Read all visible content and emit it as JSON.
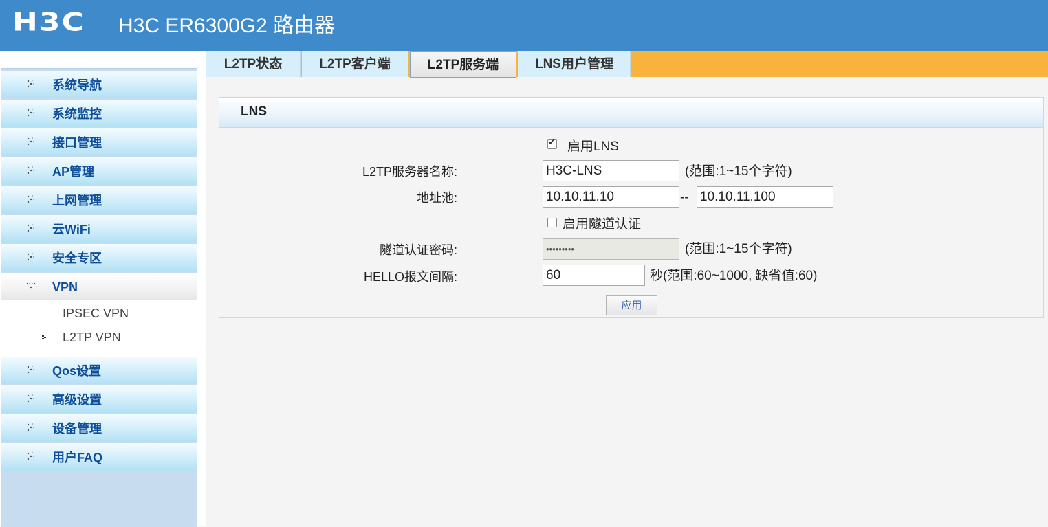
{
  "header": {
    "logo": "H3C",
    "title": "H3C ER6300G2 路由器"
  },
  "sidebar": {
    "items": [
      {
        "label": "系统导航"
      },
      {
        "label": "系统监控"
      },
      {
        "label": "接口管理"
      },
      {
        "label": "AP管理"
      },
      {
        "label": "上网管理"
      },
      {
        "label": "云WiFi"
      },
      {
        "label": "安全专区"
      },
      {
        "label": "VPN"
      },
      {
        "label": "Qos设置"
      },
      {
        "label": "高级设置"
      },
      {
        "label": "设备管理"
      },
      {
        "label": "用户FAQ"
      }
    ],
    "vpn_sub": [
      {
        "label": "IPSEC VPN"
      },
      {
        "label": "L2TP VPN"
      }
    ]
  },
  "tabs": [
    {
      "label": "L2TP状态"
    },
    {
      "label": "L2TP客户端"
    },
    {
      "label": "L2TP服务端"
    },
    {
      "label": "LNS用户管理"
    }
  ],
  "panel": {
    "title": "LNS",
    "enable_lns": {
      "label": "启用LNS",
      "checked": true
    },
    "server_name": {
      "label": "L2TP服务器名称:",
      "value": "H3C-LNS",
      "hint": "(范围:1~15个字符)"
    },
    "address_pool": {
      "label": "地址池:",
      "start": "10.10.11.10",
      "separator": "--",
      "end": "10.10.11.100"
    },
    "enable_tunnel_auth": {
      "label": "启用隧道认证",
      "checked": false
    },
    "tunnel_password": {
      "label": "隧道认证密码:",
      "value": "•••••••••",
      "hint": "(范围:1~15个字符)"
    },
    "hello_interval": {
      "label": "HELLO报文间隔:",
      "value": "60",
      "hint": "秒(范围:60~1000, 缺省值:60)"
    },
    "apply_label": "应用"
  }
}
